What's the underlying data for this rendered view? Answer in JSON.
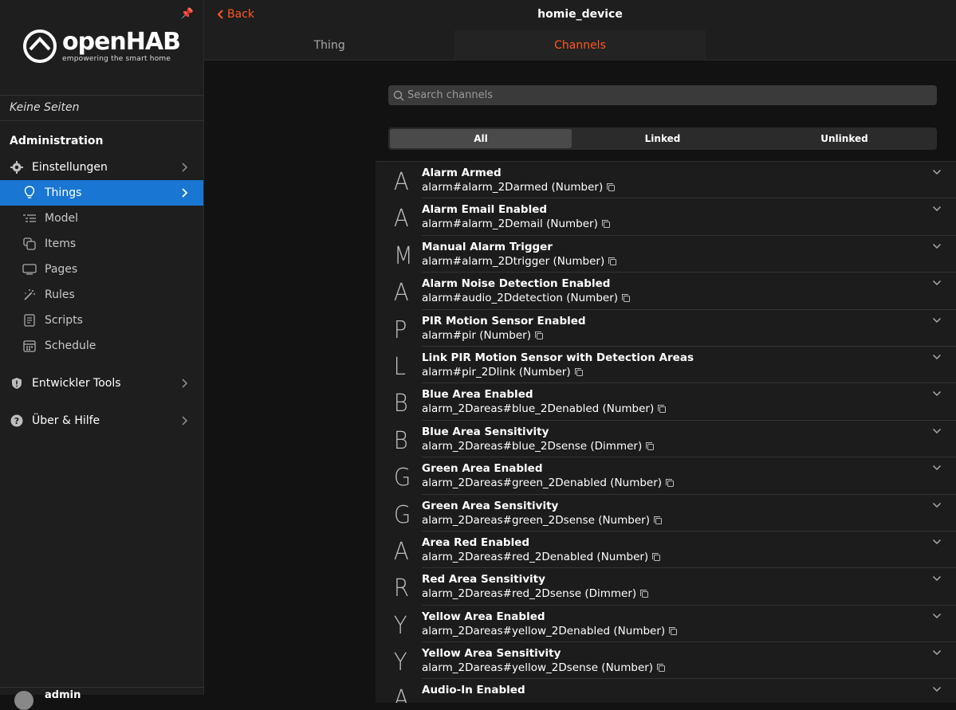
{
  "sidebar": {
    "brand": {
      "title": "openHAB",
      "tagline": "empowering the smart home"
    },
    "no_pages": "Keine Seiten",
    "section": "Administration",
    "settings": "Einstellungen",
    "things": "Things",
    "sub_items": [
      {
        "label": "Model",
        "icon": "model-icon"
      },
      {
        "label": "Items",
        "icon": "items-icon"
      },
      {
        "label": "Pages",
        "icon": "pages-icon"
      },
      {
        "label": "Rules",
        "icon": "rules-icon"
      },
      {
        "label": "Scripts",
        "icon": "scripts-icon"
      },
      {
        "label": "Schedule",
        "icon": "schedule-icon"
      }
    ],
    "dev_tools": "Entwickler Tools",
    "help": "Über & Hilfe",
    "user": "admin"
  },
  "topbar": {
    "back": "Back",
    "title": "homie_device"
  },
  "tabs": [
    {
      "label": "Thing"
    },
    {
      "label": "Channels"
    },
    {
      "label": ""
    }
  ],
  "search": {
    "placeholder": "Search channels"
  },
  "filter": {
    "all": "All",
    "linked": "Linked",
    "unlinked": "Unlinked"
  },
  "channels": [
    {
      "letter": "A",
      "name": "Alarm Armed",
      "uid": "alarm#alarm_2Darmed (Number)"
    },
    {
      "letter": "A",
      "name": "Alarm Email Enabled",
      "uid": "alarm#alarm_2Demail (Number)"
    },
    {
      "letter": "M",
      "name": "Manual Alarm Trigger",
      "uid": "alarm#alarm_2Dtrigger (Number)"
    },
    {
      "letter": "A",
      "name": "Alarm Noise Detection Enabled",
      "uid": "alarm#audio_2Ddetection (Number)"
    },
    {
      "letter": "P",
      "name": "PIR Motion Sensor Enabled",
      "uid": "alarm#pir (Number)"
    },
    {
      "letter": "L",
      "name": "Link PIR Motion Sensor with Detection Areas",
      "uid": "alarm#pir_2Dlink (Number)"
    },
    {
      "letter": "B",
      "name": "Blue Area Enabled",
      "uid": "alarm_2Dareas#blue_2Denabled (Number)"
    },
    {
      "letter": "B",
      "name": "Blue Area Sensitivity",
      "uid": "alarm_2Dareas#blue_2Dsense (Dimmer)"
    },
    {
      "letter": "G",
      "name": "Green Area Enabled",
      "uid": "alarm_2Dareas#green_2Denabled (Number)"
    },
    {
      "letter": "G",
      "name": "Green Area Sensitivity",
      "uid": "alarm_2Dareas#green_2Dsense (Number)"
    },
    {
      "letter": "A",
      "name": "Area Red Enabled",
      "uid": "alarm_2Dareas#red_2Denabled (Number)"
    },
    {
      "letter": "R",
      "name": "Red Area Sensitivity",
      "uid": "alarm_2Dareas#red_2Dsense (Dimmer)"
    },
    {
      "letter": "Y",
      "name": "Yellow Area Enabled",
      "uid": "alarm_2Dareas#yellow_2Denabled (Number)"
    },
    {
      "letter": "Y",
      "name": "Yellow Area Sensitivity",
      "uid": "alarm_2Dareas#yellow_2Dsense (Number)"
    },
    {
      "letter": "A",
      "name": "Audio-In Enabled",
      "uid": ""
    }
  ],
  "colors": {
    "accent": "#ff5722",
    "active_nav": "#1976d2"
  }
}
